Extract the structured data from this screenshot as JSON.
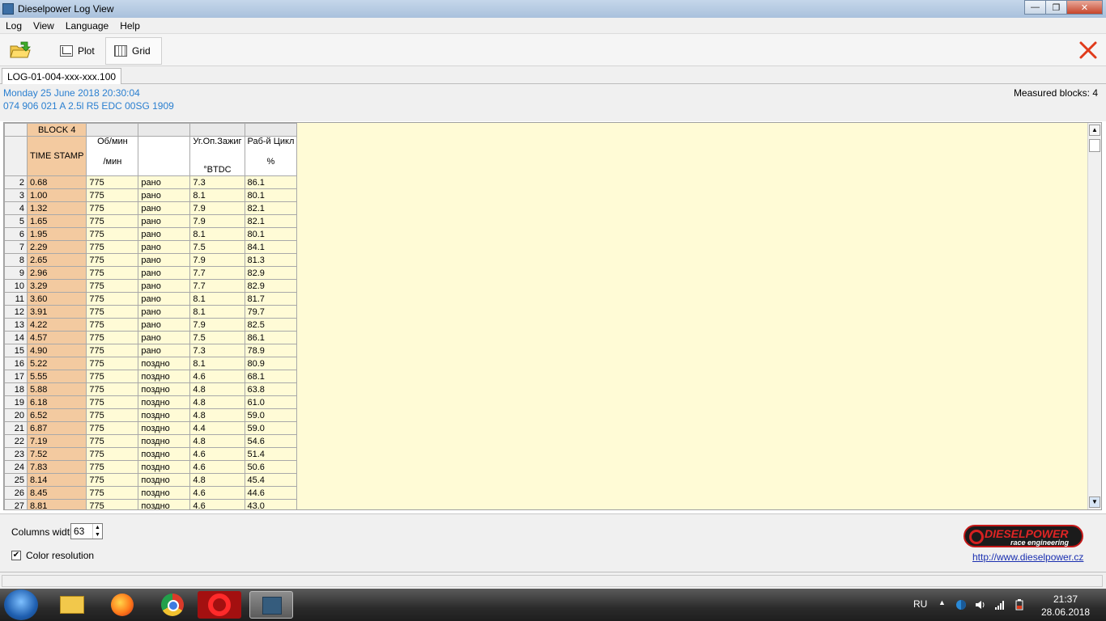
{
  "window": {
    "title": "Dieselpower Log View",
    "min_label": "—",
    "max_label": "❐",
    "close_label": "✕"
  },
  "menu": [
    "Log",
    "View",
    "Language",
    "Help"
  ],
  "toolbar": {
    "plot_label": "Plot",
    "grid_label": "Grid"
  },
  "tab": {
    "label": "LOG-01-004-xxx-xxx.100"
  },
  "info": {
    "date_line": "Monday 25 June 2018 20:30:04",
    "ecu_line": "074 906 021 A  2.5l R5 EDC   00SG  1909",
    "measured_blocks": "Measured blocks: 4"
  },
  "grid": {
    "block_label": "BLOCK 4",
    "headers": [
      {
        "title": "TIME STAMP",
        "unit": ""
      },
      {
        "title": "Об/мин",
        "unit": "/мин"
      },
      {
        "title": "",
        "unit": ""
      },
      {
        "title": "Уг.Оп.Зажиг",
        "unit": "°BTDC"
      },
      {
        "title": "Раб-й Цикл",
        "unit": "%"
      }
    ],
    "rows": [
      [
        "2",
        "0.68",
        "775",
        "рано",
        "7.3",
        "86.1"
      ],
      [
        "3",
        "1.00",
        "775",
        "рано",
        "8.1",
        "80.1"
      ],
      [
        "4",
        "1.32",
        "775",
        "рано",
        "7.9",
        "82.1"
      ],
      [
        "5",
        "1.65",
        "775",
        "рано",
        "7.9",
        "82.1"
      ],
      [
        "6",
        "1.95",
        "775",
        "рано",
        "8.1",
        "80.1"
      ],
      [
        "7",
        "2.29",
        "775",
        "рано",
        "7.5",
        "84.1"
      ],
      [
        "8",
        "2.65",
        "775",
        "рано",
        "7.9",
        "81.3"
      ],
      [
        "9",
        "2.96",
        "775",
        "рано",
        "7.7",
        "82.9"
      ],
      [
        "10",
        "3.29",
        "775",
        "рано",
        "7.7",
        "82.9"
      ],
      [
        "11",
        "3.60",
        "775",
        "рано",
        "8.1",
        "81.7"
      ],
      [
        "12",
        "3.91",
        "775",
        "рано",
        "8.1",
        "79.7"
      ],
      [
        "13",
        "4.22",
        "775",
        "рано",
        "7.9",
        "82.5"
      ],
      [
        "14",
        "4.57",
        "775",
        "рано",
        "7.5",
        "86.1"
      ],
      [
        "15",
        "4.90",
        "775",
        "рано",
        "7.3",
        "78.9"
      ],
      [
        "16",
        "5.22",
        "775",
        "поздно",
        "8.1",
        "80.9"
      ],
      [
        "17",
        "5.55",
        "775",
        "поздно",
        "4.6",
        "68.1"
      ],
      [
        "18",
        "5.88",
        "775",
        "поздно",
        "4.8",
        "63.8"
      ],
      [
        "19",
        "6.18",
        "775",
        "поздно",
        "4.8",
        "61.0"
      ],
      [
        "20",
        "6.52",
        "775",
        "поздно",
        "4.8",
        "59.0"
      ],
      [
        "21",
        "6.87",
        "775",
        "поздно",
        "4.4",
        "59.0"
      ],
      [
        "22",
        "7.19",
        "775",
        "поздно",
        "4.8",
        "54.6"
      ],
      [
        "23",
        "7.52",
        "775",
        "поздно",
        "4.6",
        "51.4"
      ],
      [
        "24",
        "7.83",
        "775",
        "поздно",
        "4.6",
        "50.6"
      ],
      [
        "25",
        "8.14",
        "775",
        "поздно",
        "4.8",
        "45.4"
      ],
      [
        "26",
        "8.45",
        "775",
        "поздно",
        "4.6",
        "44.6"
      ],
      [
        "27",
        "8.81",
        "775",
        "поздно",
        "4.6",
        "43.0"
      ]
    ]
  },
  "bottom": {
    "columns_width_label": "Columns width:",
    "columns_width_value": "63",
    "color_resolution_label": "Color resolution",
    "color_resolution_checked": "✔",
    "logo_name": "DIESELPOWER",
    "logo_sub": "race engineering",
    "url": "http://www.dieselpower.cz"
  },
  "taskbar": {
    "lang": "RU",
    "time": "21:37",
    "date": "28.06.2018"
  },
  "colors": {
    "accent_info": "#2a7fd0",
    "grid_background": "#fffbd6",
    "timestamp_column": "#f3caa0",
    "close_icon": "#e03a1a"
  }
}
